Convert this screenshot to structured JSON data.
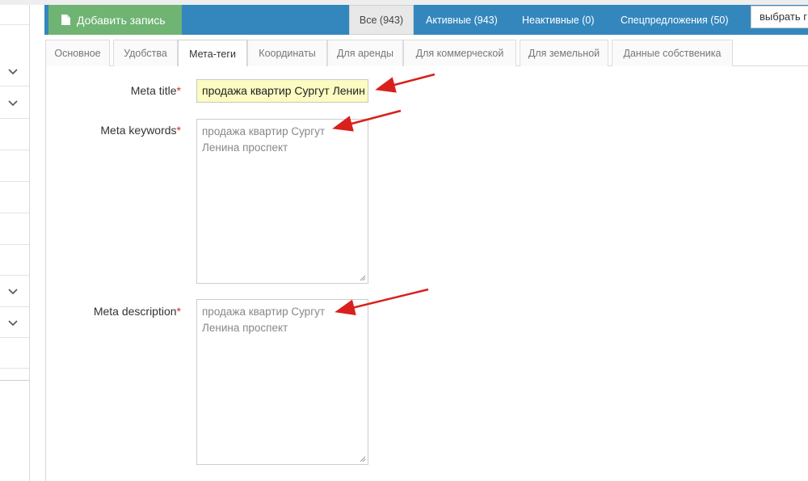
{
  "header": {
    "add_record_label": "Добавить запись",
    "filters": {
      "all": "Все (943)",
      "active": "Активные (943)",
      "inactive": "Неактивные (0)",
      "special": "Спецпредложения (50)"
    },
    "select_value": "выбрать г"
  },
  "tabs": [
    {
      "label": "Основное"
    },
    {
      "label": "Удобства"
    },
    {
      "label": "Мета-теги",
      "active": true
    },
    {
      "label": "Координаты"
    },
    {
      "label": "Для аренды"
    },
    {
      "label": "Для коммерческой"
    },
    {
      "label": "Для земельной"
    },
    {
      "label": "Данные собственика"
    }
  ],
  "form": {
    "meta_title": {
      "label": "Meta title",
      "required_mark": "*",
      "value": "продажа квартир Сургут Ленин"
    },
    "meta_keywords": {
      "label": "Meta keywords",
      "required_mark": "*",
      "value": "продажа квартир Сургут Ленина проспект"
    },
    "meta_description": {
      "label": "Meta description",
      "required_mark": "*",
      "value": "продажа квартир Сургут Ленина проспект"
    }
  },
  "colors": {
    "topbar": "#3487bd",
    "add_button": "#6fb473",
    "title_input_bg": "#fbfbc2",
    "required": "#c9302c",
    "annotation_arrow": "#d9201c"
  },
  "icons": {
    "add_button": "document-icon",
    "sidebar": "chevron-down-icon",
    "textarea_resize": "resize-grip-icon",
    "annotation": "arrow-icon"
  }
}
